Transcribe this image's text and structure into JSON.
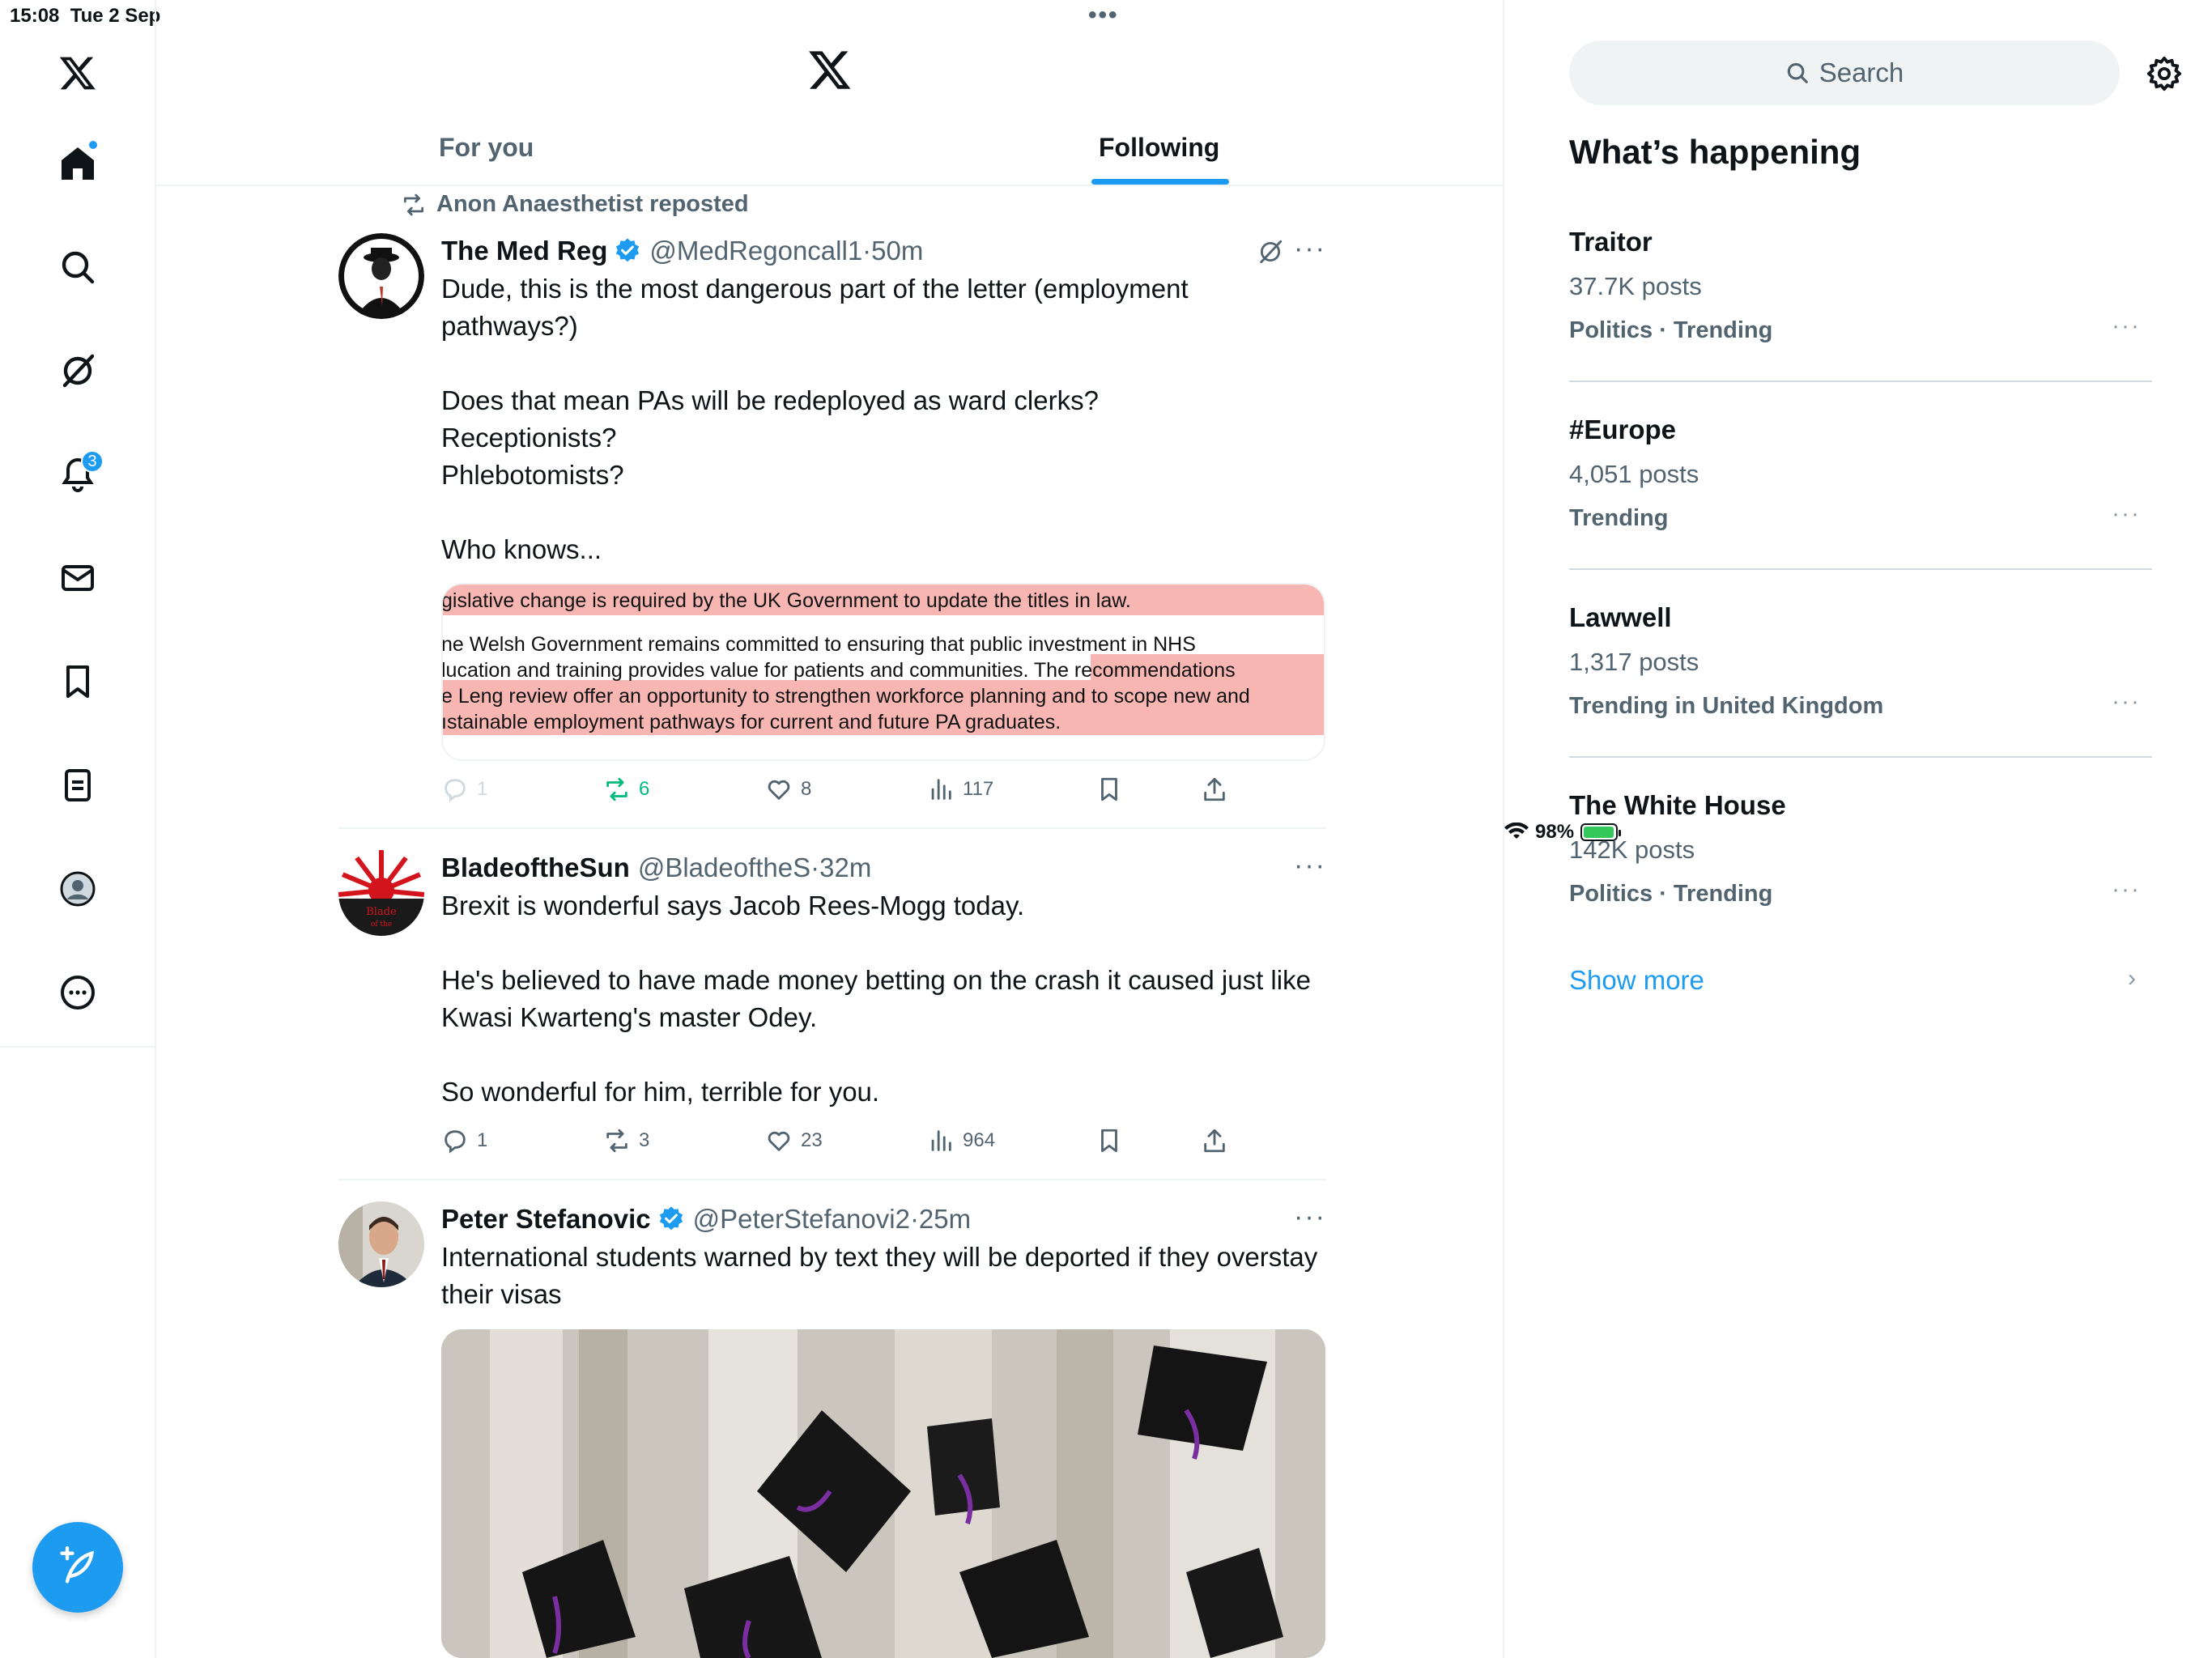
{
  "status_bar": {
    "time": "15:08",
    "date": "Tue 2 Sep",
    "battery": "98%",
    "battery_level": 0.98,
    "dots": "•••"
  },
  "nav": {
    "items": [
      {
        "name": "home-icon"
      },
      {
        "name": "search-icon"
      },
      {
        "name": "grok-icon"
      },
      {
        "name": "notifications-icon",
        "badge": "3"
      },
      {
        "name": "messages-icon"
      },
      {
        "name": "bookmarks-icon"
      },
      {
        "name": "lists-icon"
      },
      {
        "name": "profile-icon"
      },
      {
        "name": "more-icon"
      }
    ]
  },
  "tabs": [
    {
      "label": "For you",
      "active": false
    },
    {
      "label": "Following",
      "active": true
    }
  ],
  "tweets": [
    {
      "repost_by": "Anon Anaesthetist reposted",
      "name": "The Med Reg",
      "verified": true,
      "handle": "@MedRegoncall1",
      "time": "·50m",
      "text": "Dude, this is the most dangerous part of the letter (employment pathways?)\n\nDoes that mean PAs will be redeployed as ward clerks?\nReceptionists?\nPhlebotomists?\n\nWho knows...",
      "image_lines": [
        "gislative change is required by the UK Government to update the titles in law.",
        "ne Welsh Government remains committed to ensuring that public investment in NHS",
        "lucation and training provides value for patients and communities. The recommendations",
        "e Leng review offer an opportunity to strengthen workforce planning and to scope new and",
        "ıstainable employment pathways for current and future PA graduates."
      ],
      "replies": "1",
      "reposts": "6",
      "likes": "8",
      "views": "117"
    },
    {
      "name": "BladeoftheSun",
      "verified": false,
      "handle": "@BladeoftheS",
      "time": "·32m",
      "text": "Brexit is wonderful says Jacob Rees-Mogg today.\n\nHe's believed to have made money betting on the crash it caused just like Kwasi Kwarteng's master Odey.\n\nSo wonderful for him, terrible for you.",
      "replies": "1",
      "reposts": "3",
      "likes": "23",
      "views": "964"
    },
    {
      "name": "Peter Stefanovic",
      "verified": true,
      "handle": "@PeterStefanovi2",
      "time": "·25m",
      "text": "International students warned by text they will be deported if they overstay their visas"
    }
  ],
  "sidebar": {
    "search_placeholder": "Search",
    "title": "What’s happening",
    "trends": [
      {
        "name": "Traitor",
        "count": "37.7K posts",
        "category": "Politics · Trending"
      },
      {
        "name": "#Europe",
        "count": "4,051 posts",
        "category": "Trending"
      },
      {
        "name": "Lawwell",
        "count": "1,317 posts",
        "category": "Trending in United Kingdom"
      },
      {
        "name": "The White House",
        "count": "142K posts",
        "category": "Politics · Trending"
      }
    ],
    "show_more": "Show more"
  },
  "colors": {
    "accent": "#1d9bf0",
    "secondary_text": "#536471",
    "repost_green": "#00ba7c"
  }
}
